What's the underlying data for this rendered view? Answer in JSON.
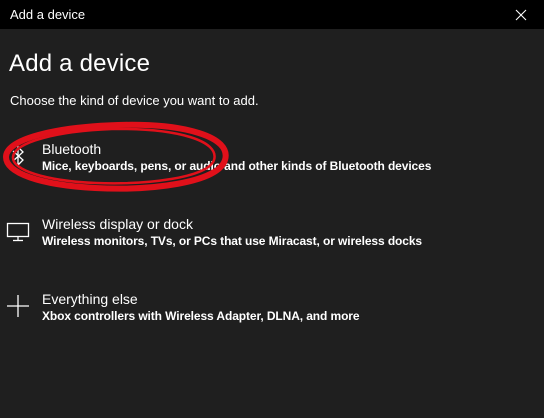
{
  "window": {
    "title": "Add a device"
  },
  "main": {
    "heading": "Add a device",
    "subheading": "Choose the kind of device you want to add."
  },
  "options": [
    {
      "title": "Bluetooth",
      "description": "Mice, keyboards, pens, or audio and other kinds of Bluetooth devices",
      "icon": "bluetooth-icon"
    },
    {
      "title": "Wireless display or dock",
      "description": "Wireless monitors, TVs, or PCs that use Miracast, or wireless docks",
      "icon": "monitor-icon"
    },
    {
      "title": "Everything else",
      "description": "Xbox controllers with Wireless Adapter, DLNA, and more",
      "icon": "plus-icon"
    }
  ],
  "colors": {
    "background": "#1f1f1f",
    "titlebar": "#000000",
    "text": "#ffffff",
    "annotation": "#e0101a"
  }
}
